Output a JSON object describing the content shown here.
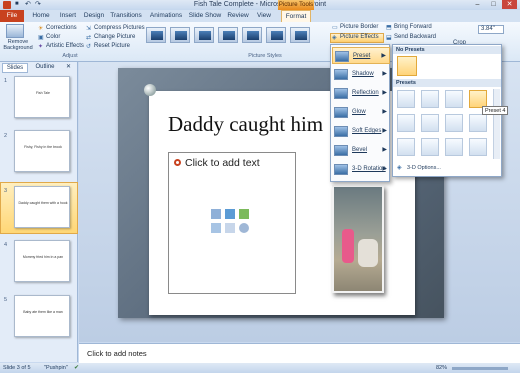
{
  "window": {
    "title": "Fish Tale Complete - Microsoft PowerPoint",
    "contextual_tab": "Picture Tools"
  },
  "tabs": [
    "Home",
    "Insert",
    "Design",
    "Transitions",
    "Animations",
    "Slide Show",
    "Review",
    "View",
    "Format"
  ],
  "file_tab": "File",
  "ribbon": {
    "remove_background": "Remove Background",
    "corrections": "Corrections",
    "color": "Color",
    "artistic_effects": "Artistic Effects",
    "compress": "Compress Pictures",
    "change": "Change Picture",
    "reset": "Reset Picture",
    "adjust_label": "Adjust",
    "picture_styles_label": "Picture Styles",
    "picture_border": "Picture Border",
    "picture_effects": "Picture Effects",
    "bring_forward": "Bring Forward",
    "send_backward": "Send Backward",
    "size_value": "3.84\"",
    "crop": "Crop"
  },
  "panes": {
    "slides_tab": "Slides",
    "outline_tab": "Outline"
  },
  "thumbnails": [
    {
      "num": "1",
      "caption": "Fish Tale"
    },
    {
      "num": "2",
      "caption": "Fishy, Fishy in the brook"
    },
    {
      "num": "3",
      "caption": "Daddy caught them with a hook"
    },
    {
      "num": "4",
      "caption": "Mommy fried him in a pan"
    },
    {
      "num": "5",
      "caption": "Baby ate them like a man"
    }
  ],
  "slide": {
    "title": "Daddy caught him",
    "placeholder": "Click to add text"
  },
  "notes_placeholder": "Click to add notes",
  "effects_menu": [
    {
      "label": "Preset",
      "icon": "preset-icon"
    },
    {
      "label": "Shadow",
      "icon": "shadow-icon"
    },
    {
      "label": "Reflection",
      "icon": "reflection-icon"
    },
    {
      "label": "Glow",
      "icon": "glow-icon"
    },
    {
      "label": "Soft Edges",
      "icon": "soft-edges-icon"
    },
    {
      "label": "Bevel",
      "icon": "bevel-icon"
    },
    {
      "label": "3-D Rotation",
      "icon": "rotation-icon"
    }
  ],
  "gallery": {
    "no_presets": "No Presets",
    "presets": "Presets",
    "options": "3-D Options...",
    "tooltip": "Preset 4"
  },
  "status": {
    "slide": "Slide 3 of 5",
    "theme": "\"Pushpin\"",
    "zoom": "82%"
  },
  "colors": {
    "file_tab": "#c8421f",
    "contextual_tab": "#e98a1c",
    "highlight": "#ffd98c"
  }
}
